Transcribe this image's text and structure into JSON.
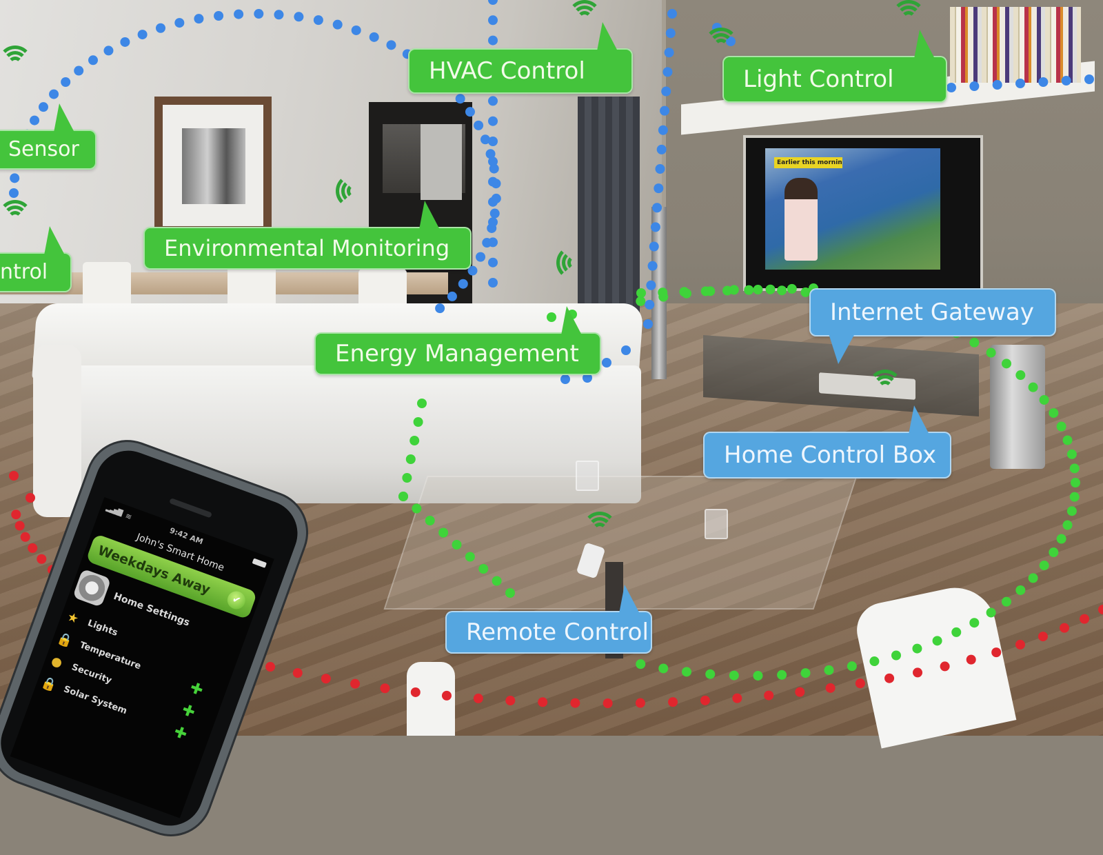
{
  "scene": {
    "description": "Smart home living room illustration with connected device labels",
    "tv_banner": "Earlier this morning"
  },
  "colors": {
    "green_bubble": "#44c43c",
    "blue_bubble": "#55a6e0",
    "blue_network": "#3d87e6",
    "green_network": "#3fd33a",
    "red_network": "#e0262e",
    "wifi_icon": "#2fa437"
  },
  "labels": {
    "sensor": "Sensor",
    "control_left": "ntrol",
    "hvac": "HVAC Control",
    "light": "Light Control",
    "environmental": "Environmental Monitoring",
    "energy": "Energy Management",
    "internet_gateway": "Internet Gateway",
    "home_control_box": "Home Control Box",
    "remote_control": "Remote Control"
  },
  "phone": {
    "time": "9:42 AM",
    "app_title": "John's Smart Home",
    "mode": "Weekdays Away",
    "settings_label": "Home Settings",
    "items": [
      {
        "icon": "star-icon",
        "glyph": "★",
        "label": "Lights"
      },
      {
        "icon": "lock-icon",
        "glyph": "🔒",
        "label": "Temperature"
      },
      {
        "icon": "sun-icon",
        "glyph": "●",
        "label": "Security"
      },
      {
        "icon": "lock-icon",
        "glyph": "🔒",
        "label": "Solar System"
      }
    ],
    "add_glyph": "✚",
    "check_glyph": "✔",
    "signal_glyph": "▂▃▅▇",
    "wifi_glyph": "≋"
  }
}
